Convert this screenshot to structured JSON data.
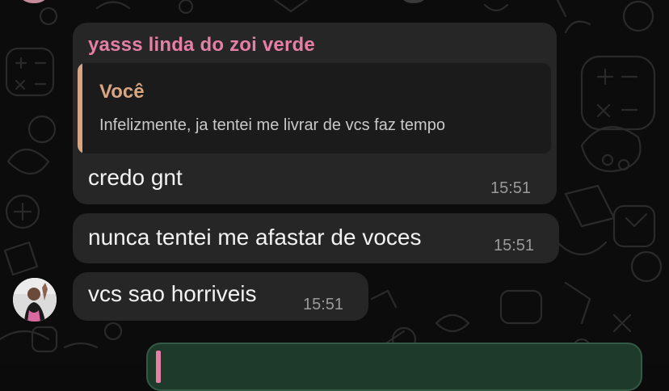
{
  "conversation": {
    "messages": [
      {
        "sender": "yasss linda do zoi verde",
        "quote": {
          "author": "Você",
          "text": "Infelizmente, ja tentei me livrar de vcs faz tempo"
        },
        "text": "credo gnt",
        "time": "15:51"
      },
      {
        "text": "nunca tentei me afastar de voces",
        "time": "15:51"
      },
      {
        "text": "vcs sao horriveis",
        "time": "15:51"
      }
    ]
  },
  "colors": {
    "background": "#0c0c0c",
    "incoming_bubble": "#262626",
    "quote_background": "#1b1b1b",
    "sender_name": "#e67fa6",
    "quote_accent": "#d9a583",
    "outgoing_bubble": "#1e3a2b",
    "timestamp": "#9a9a9a"
  },
  "icons": {
    "avatar": "user-avatar-photo",
    "wallpaper": "chat-doodle-pattern"
  }
}
